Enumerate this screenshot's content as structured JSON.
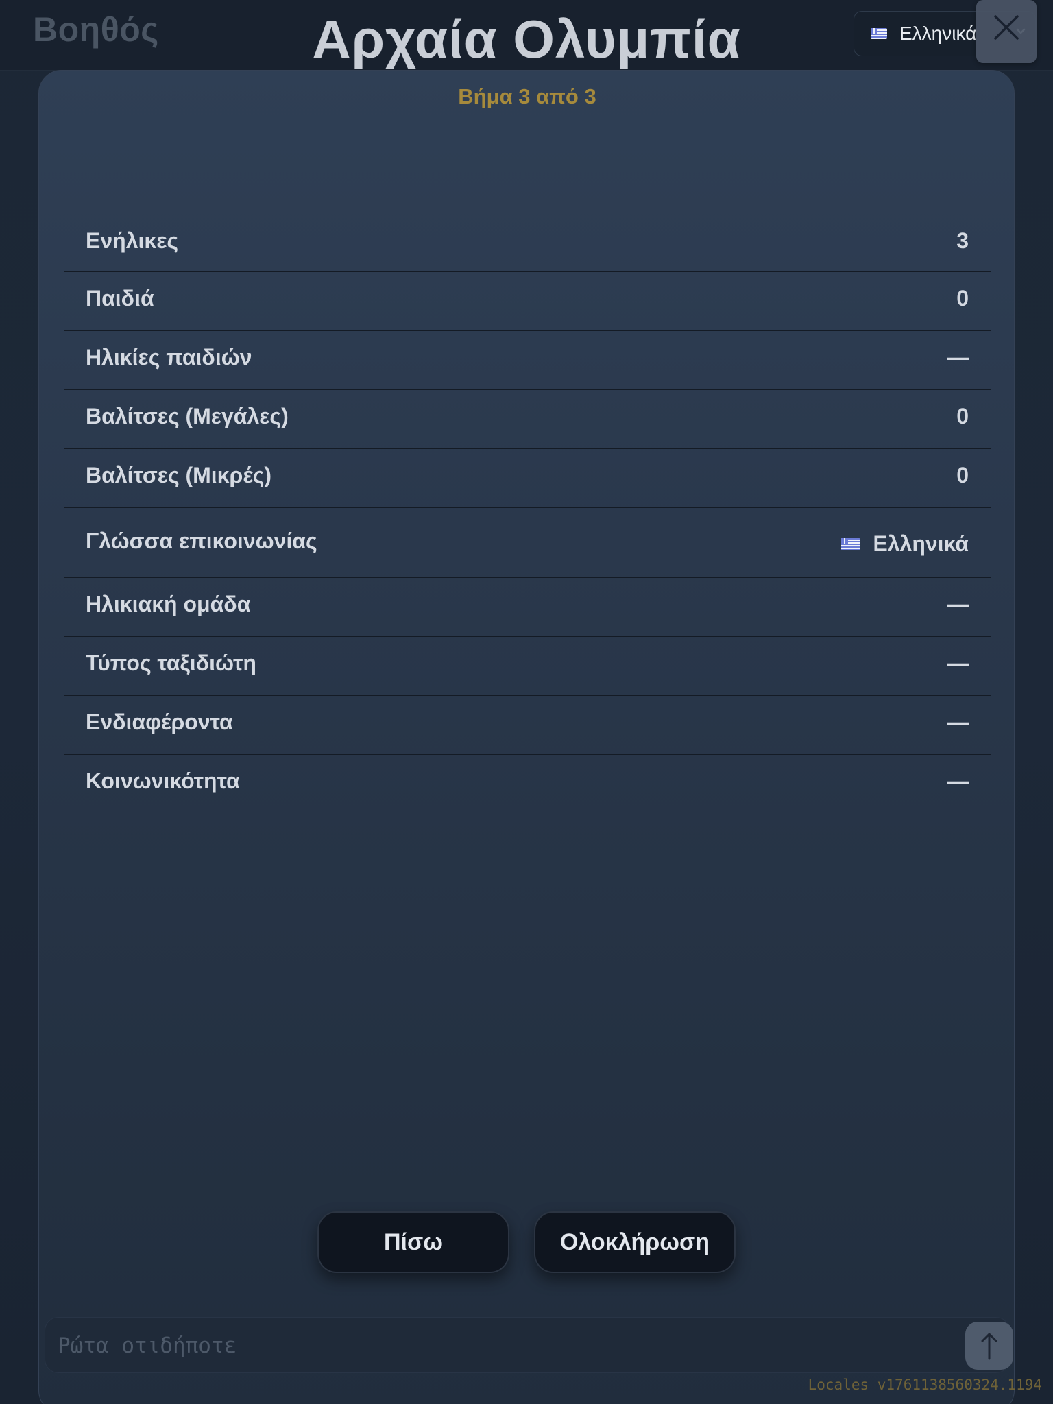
{
  "header": {
    "brand": "Βοηθός",
    "title": "Αρχαία Ολυμπία",
    "language_selector": {
      "selected": "Ελληνικά",
      "flag": "greek-flag-icon"
    },
    "close_icon": "close-icon"
  },
  "wizard": {
    "step_label": "Βήμα 3 από 3",
    "rows": [
      {
        "label": "Ενήλικες",
        "value": "3"
      },
      {
        "label": "Παιδιά",
        "value": "0"
      },
      {
        "label": "Ηλικίες παιδιών",
        "value": "—"
      },
      {
        "label": "Βαλίτσες (Μεγάλες)",
        "value": "0"
      },
      {
        "label": "Βαλίτσες (Μικρές)",
        "value": "0"
      },
      {
        "label": "Γλώσσα επικοινωνίας",
        "value": "Ελληνικά",
        "flag": "greek-flag-icon"
      },
      {
        "label": "Ηλικιακή ομάδα",
        "value": "—"
      },
      {
        "label": "Τύπος ταξιδιώτη",
        "value": "—"
      },
      {
        "label": "Ενδιαφέροντα",
        "value": "—"
      },
      {
        "label": "Κοινωνικότητα",
        "value": "—"
      }
    ],
    "back_label": "Πίσω",
    "finish_label": "Ολοκλήρωση"
  },
  "chat": {
    "placeholder": "Ρώτα οτιδήποτε",
    "value": "",
    "send_icon": "arrow-up-icon"
  },
  "footer": {
    "version": "Locales v1761138560324.1194"
  },
  "colors": {
    "accent": "#a68a3c",
    "background": "#1c2735",
    "card": "#2a384c",
    "button": "#0f151f"
  }
}
